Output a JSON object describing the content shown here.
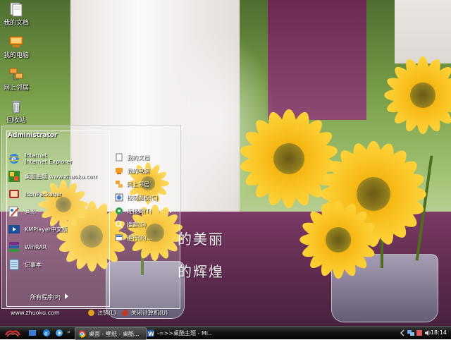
{
  "wallpaper": {
    "text_line1": "的美丽",
    "text_line2": "的辉煌"
  },
  "desktop": {
    "icons": [
      {
        "label": "我的文档",
        "icon": "my-documents-icon"
      },
      {
        "label": "我的电脑",
        "icon": "my-computer-icon"
      },
      {
        "label": "网上邻居",
        "icon": "network-places-icon"
      },
      {
        "label": "回收站",
        "icon": "recycle-bin-icon"
      }
    ]
  },
  "start_menu": {
    "user_name": "Administrator",
    "pinned": [
      {
        "line1": "Internet",
        "line2": "Internet Explorer",
        "icon": "internet-explorer-icon"
      },
      {
        "line1": "桌面主题 www.zhuoku.com",
        "line2": "",
        "icon": "theme-icon"
      },
      {
        "line1": "IconPackager",
        "line2": "",
        "icon": "iconpackager-icon"
      },
      {
        "line1": "画图",
        "line2": "",
        "icon": "paint-icon"
      },
      {
        "line1": "KMPlayer中文版",
        "line2": "",
        "icon": "kmplayer-icon"
      },
      {
        "line1": "WinRAR",
        "line2": "",
        "icon": "winrar-icon"
      },
      {
        "line1": "记事本",
        "line2": "",
        "icon": "notepad-icon"
      }
    ],
    "all_programs": "所有程序(P)",
    "places": [
      {
        "label": "我的文档",
        "icon": "my-documents-icon"
      },
      {
        "label": "我的电脑",
        "icon": "my-computer-icon"
      },
      {
        "label": "网上邻居",
        "icon": "network-places-icon"
      },
      {
        "label": "控制面板(C)",
        "icon": "control-panel-icon"
      },
      {
        "label": "连接到(T)",
        "icon": "connect-to-icon",
        "submenu": true
      },
      {
        "label": "搜索(S)",
        "icon": "search-icon"
      },
      {
        "label": "运行(R)...",
        "icon": "run-icon"
      }
    ],
    "footer": {
      "site": "www.zhuoku.com",
      "logoff": "注销(L)",
      "shutdown": "关闭计算机(U)"
    }
  },
  "taskbar": {
    "tasks": [
      {
        "label": "桌面 - 壁纸 - 桌酷...",
        "icon": "chrome-icon"
      },
      {
        "label": "-=>>桌酷主题 - Mi...",
        "icon": "word-icon"
      }
    ],
    "clock": "18:14"
  },
  "colors": {
    "taskbar": "#0a0a0a",
    "petal": "#f5b814"
  }
}
